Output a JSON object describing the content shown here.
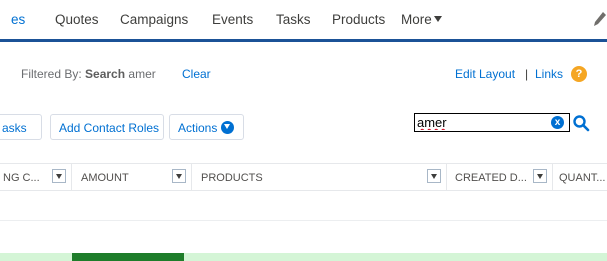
{
  "nav": {
    "items": [
      {
        "label": "es",
        "active": true
      },
      {
        "label": "Quotes"
      },
      {
        "label": "Campaigns"
      },
      {
        "label": "Events"
      },
      {
        "label": "Tasks"
      },
      {
        "label": "Products"
      },
      {
        "label": "More"
      }
    ],
    "accent_color": "#1b5297"
  },
  "filter": {
    "prefix": "Filtered By:",
    "field": "Search",
    "value": "amer",
    "clear_label": "Clear"
  },
  "header_links": {
    "edit_layout": "Edit Layout",
    "separator": "|",
    "links": "Links",
    "help_icon": "?"
  },
  "toolbar": {
    "tasks_label": "asks",
    "add_contact_roles_label": "Add Contact Roles",
    "actions_label": "Actions"
  },
  "search": {
    "value": "amer",
    "clear_icon": "x"
  },
  "columns": [
    {
      "label": "NG C..."
    },
    {
      "label": "AMOUNT"
    },
    {
      "label": "PRODUCTS"
    },
    {
      "label": "CREATED D..."
    },
    {
      "label": "QUANT..."
    }
  ],
  "colors": {
    "link": "#0070d2",
    "highlight_row": "#d4f5d6",
    "highlight_cell": "#1e7d2a"
  }
}
